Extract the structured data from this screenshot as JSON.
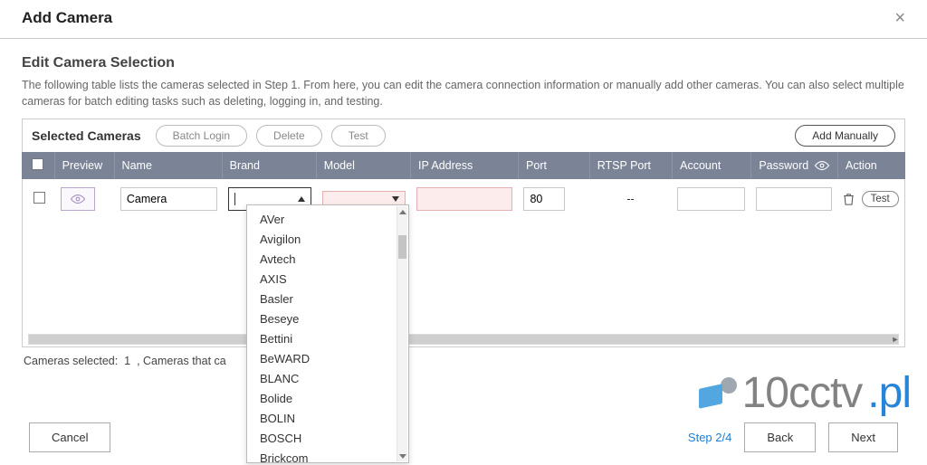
{
  "dialog": {
    "title": "Add Camera"
  },
  "section": {
    "title": "Edit Camera Selection",
    "description": "The following table lists the cameras selected in Step 1. From here, you can edit the camera connection information or manually add other cameras. You can also select multiple cameras for batch editing tasks such as deleting, logging in, and testing."
  },
  "panel": {
    "label": "Selected Cameras",
    "batch_login": "Batch Login",
    "delete": "Delete",
    "test": "Test",
    "add_manually": "Add Manually"
  },
  "columns": {
    "preview": "Preview",
    "name": "Name",
    "brand": "Brand",
    "model": "Model",
    "ip": "IP Address",
    "port": "Port",
    "rtsp": "RTSP Port",
    "account": "Account",
    "password": "Password",
    "action": "Action"
  },
  "row": {
    "name": "Camera",
    "brand": "",
    "model": "",
    "ip": "",
    "port": "80",
    "rtsp": "--",
    "account": "",
    "password": "",
    "test": "Test"
  },
  "brand_options": [
    "AVer",
    "Avigilon",
    "Avtech",
    "AXIS",
    "Basler",
    "Beseye",
    "Bettini",
    "BeWARD",
    "BLANC",
    "Bolide",
    "BOLIN",
    "BOSCH",
    "Brickcom"
  ],
  "status": {
    "prefix": "Cameras selected:",
    "count": "1",
    "suffix": ", Cameras that ca"
  },
  "footer": {
    "cancel": "Cancel",
    "step": "Step 2/4",
    "back": "Back",
    "next": "Next"
  },
  "watermark": {
    "a": "10cctv",
    "b": ".pl"
  }
}
